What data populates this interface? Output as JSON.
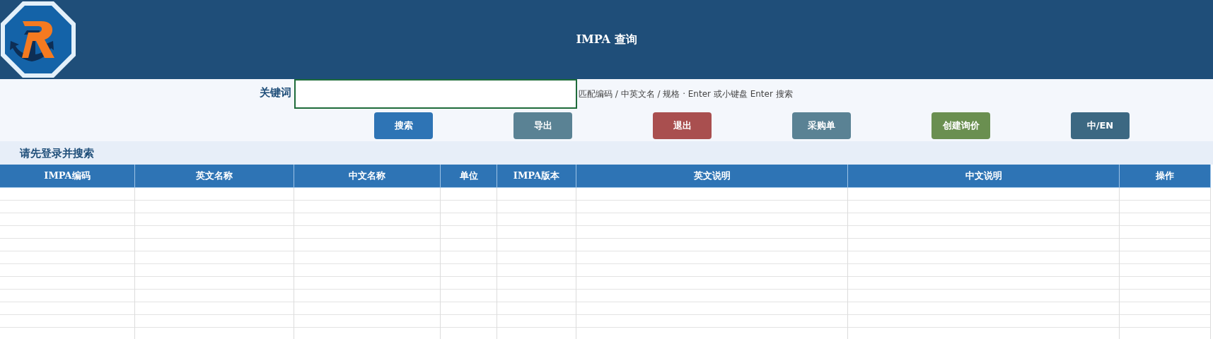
{
  "header": {
    "title": "IMPA 查询"
  },
  "search": {
    "label": "关键词",
    "hint": "匹配编码 / 中英文名 / 规格 · Enter 或小键盘 Enter 搜索"
  },
  "buttons": [
    {
      "label": "搜索",
      "color": "#2e74b5"
    },
    {
      "label": "导出",
      "color": "#5a8294"
    },
    {
      "label": "退出",
      "color": "#a94f4f"
    },
    {
      "label": "采购单",
      "color": "#5a8294"
    },
    {
      "label": "创建询价",
      "color": "#6a8f50"
    },
    {
      "label": "中/EN",
      "color": "#3c6882"
    }
  ],
  "status": "请先登录并搜索",
  "table": {
    "columns": [
      "IMPA编码",
      "英文名称",
      "中文名称",
      "单位",
      "IMPA版本",
      "英文说明",
      "中文说明",
      "操作"
    ]
  }
}
